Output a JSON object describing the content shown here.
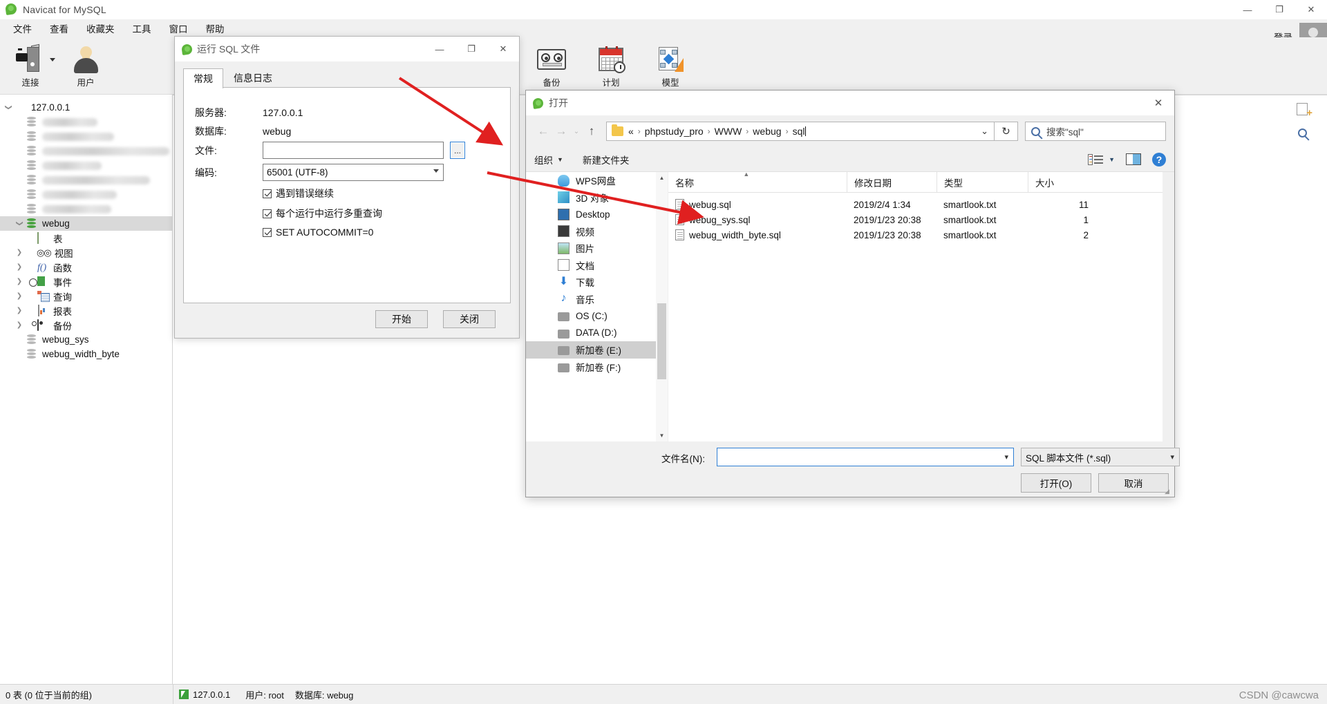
{
  "app": {
    "title": "Navicat for MySQL",
    "login_label": "登录",
    "window_controls": {
      "minimize": "—",
      "maximize": "❐",
      "close": "✕"
    }
  },
  "menubar": {
    "items": [
      "文件",
      "查看",
      "收藏夹",
      "工具",
      "窗口",
      "帮助"
    ]
  },
  "toolbar": {
    "items": [
      {
        "label": "连接",
        "icon": "connection-icon"
      },
      {
        "label": "用户",
        "icon": "user-icon"
      },
      {
        "label": "备份",
        "icon": "backup-icon"
      },
      {
        "label": "计划",
        "icon": "schedule-icon"
      },
      {
        "label": "模型",
        "icon": "model-icon"
      }
    ]
  },
  "sidebar": {
    "host": "127.0.0.1",
    "blurred_count": 7,
    "selected_db": "webug",
    "db_children": [
      {
        "label": "表",
        "icon": "table-icon",
        "expandable": false
      },
      {
        "label": "视图",
        "icon": "view-icon",
        "expandable": true
      },
      {
        "label": "函数",
        "icon": "function-icon",
        "expandable": true
      },
      {
        "label": "事件",
        "icon": "event-icon",
        "expandable": true
      },
      {
        "label": "查询",
        "icon": "query-icon",
        "expandable": true
      },
      {
        "label": "报表",
        "icon": "report-icon",
        "expandable": true
      },
      {
        "label": "备份",
        "icon": "backup-small-icon",
        "expandable": true
      }
    ],
    "other_dbs": [
      "webug_sys",
      "webug_width_byte"
    ]
  },
  "statusbar": {
    "left": "0 表 (0 位于当前的组)",
    "host": "127.0.0.1",
    "user": "用户: root",
    "database": "数据库: webug"
  },
  "sql_dialog": {
    "title": "运行 SQL 文件",
    "tabs": [
      {
        "label": "常规",
        "active": true
      },
      {
        "label": "信息日志",
        "active": false
      }
    ],
    "fields": [
      {
        "label": "服务器:",
        "value": "127.0.0.1"
      },
      {
        "label": "数据库:",
        "value": "webug"
      }
    ],
    "file_label": "文件:",
    "file_value": "",
    "browse_label": "...",
    "encoding_label": "编码:",
    "encoding_value": "65001 (UTF-8)",
    "checkboxes": [
      {
        "label": "遇到错误继续",
        "checked": true
      },
      {
        "label": "每个运行中运行多重查询",
        "checked": true
      },
      {
        "label": "SET AUTOCOMMIT=0",
        "checked": true
      }
    ],
    "start_button": "开始",
    "close_button": "关闭",
    "window_controls": {
      "minimize": "—",
      "maximize": "❐",
      "close": "✕"
    }
  },
  "open_dialog": {
    "title": "打开",
    "close": "✕",
    "nav": {
      "back": "←",
      "forward": "→",
      "recent": "⌄",
      "up": "↑"
    },
    "breadcrumb": {
      "prefix": "«",
      "parts": [
        "phpstudy_pro",
        "WWW",
        "webug",
        "sql"
      ],
      "dropdown": "⌄"
    },
    "refresh": "↻",
    "search_placeholder": "搜索\"sql\"",
    "toolbar": {
      "organize": "组织",
      "organize_caret": "▼",
      "new_folder": "新建文件夹"
    },
    "sidebar_items": [
      {
        "label": "WPS网盘",
        "icon": "cloud-icon",
        "selected": false
      },
      {
        "label": "3D 对象",
        "icon": "3d-object-icon",
        "selected": false
      },
      {
        "label": "Desktop",
        "icon": "desktop-icon",
        "selected": false
      },
      {
        "label": "视频",
        "icon": "video-icon",
        "selected": false
      },
      {
        "label": "图片",
        "icon": "picture-icon",
        "selected": false
      },
      {
        "label": "文档",
        "icon": "document-icon",
        "selected": false
      },
      {
        "label": "下载",
        "icon": "download-icon",
        "selected": false
      },
      {
        "label": "音乐",
        "icon": "music-icon",
        "selected": false
      },
      {
        "label": "OS (C:)",
        "icon": "drive-icon",
        "selected": false
      },
      {
        "label": "DATA (D:)",
        "icon": "drive-icon",
        "selected": false
      },
      {
        "label": "新加卷 (E:)",
        "icon": "drive-icon",
        "selected": true
      },
      {
        "label": "新加卷 (F:)",
        "icon": "drive-icon",
        "selected": false
      }
    ],
    "columns": [
      "名称",
      "修改日期",
      "类型",
      "大小"
    ],
    "files": [
      {
        "name": "webug.sql",
        "modified": "2019/2/4 1:34",
        "type": "smartlook.txt",
        "size": "11"
      },
      {
        "name": "webug_sys.sql",
        "modified": "2019/1/23 20:38",
        "type": "smartlook.txt",
        "size": "1"
      },
      {
        "name": "webug_width_byte.sql",
        "modified": "2019/1/23 20:38",
        "type": "smartlook.txt",
        "size": "2"
      }
    ],
    "filename_label": "文件名(N):",
    "filename_value": "",
    "filetype_value": "SQL 脚本文件 (*.sql)",
    "open_button": "打开(O)",
    "cancel_button": "取消"
  },
  "watermark": "CSDN @cawcwa",
  "colors": {
    "accent_blue": "#2f7fd4",
    "arrow_red": "#e02020",
    "selection_gray": "#d9d9d9",
    "navicat_green": "#48a23f"
  }
}
